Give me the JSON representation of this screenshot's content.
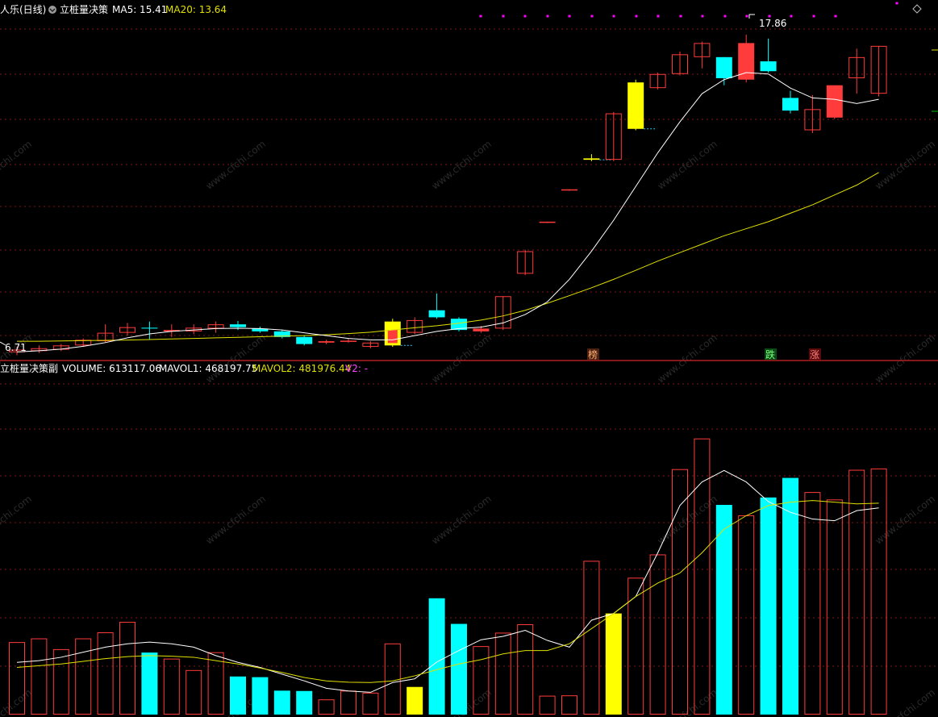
{
  "main_header": {
    "stock_name": "人乐(日线)",
    "indicator": "立桩量决策",
    "ma5_label": "MA5: 15.41",
    "ma20_label": "MA20: 13.64"
  },
  "sub_header": {
    "indicator": "立桩量决策副",
    "volume_label": "VOLUME: 613117.06",
    "mavol1_label": "MAVOL1: 468197.75",
    "mavol2_label": "MAVOL2: 481976.44",
    "v2_label": "V2: -"
  },
  "annotations": {
    "high_label": "17.86",
    "low_label": "6.71",
    "badge_bang": "榜",
    "badge_die": "跌",
    "badge_zhang": "涨"
  },
  "watermark": "www.cfchi.com",
  "colors": {
    "up": "#ff3b3b",
    "down": "#00ffff",
    "yellow": "#ffff00",
    "ma5": "#ffffff",
    "ma20": "#e0e000",
    "grid": "#7a1a1a",
    "separator": "#b02020",
    "magenta": "#ff00ff"
  },
  "chart_data": [
    {
      "type": "candlestick",
      "title": "立桩量决策",
      "price_axis_range": [
        6.5,
        18.6
      ],
      "candles": [
        {
          "o": 6.71,
          "h": 6.9,
          "l": 6.6,
          "c": 6.8,
          "style": "up"
        },
        {
          "o": 6.75,
          "h": 6.95,
          "l": 6.68,
          "c": 6.85,
          "style": "up"
        },
        {
          "o": 6.8,
          "h": 7.0,
          "l": 6.75,
          "c": 6.95,
          "style": "up"
        },
        {
          "o": 6.95,
          "h": 7.2,
          "l": 6.9,
          "c": 7.15,
          "style": "up"
        },
        {
          "o": 7.1,
          "h": 7.7,
          "l": 7.05,
          "c": 7.4,
          "style": "up"
        },
        {
          "o": 7.4,
          "h": 7.75,
          "l": 7.3,
          "c": 7.6,
          "style": "up"
        },
        {
          "o": 7.58,
          "h": 7.8,
          "l": 7.15,
          "c": 7.55,
          "style": "down"
        },
        {
          "o": 7.5,
          "h": 7.7,
          "l": 7.25,
          "c": 7.45,
          "style": "up"
        },
        {
          "o": 7.45,
          "h": 7.7,
          "l": 7.35,
          "c": 7.58,
          "style": "up"
        },
        {
          "o": 7.55,
          "h": 7.8,
          "l": 7.4,
          "c": 7.7,
          "style": "up"
        },
        {
          "o": 7.7,
          "h": 7.82,
          "l": 7.5,
          "c": 7.6,
          "style": "down"
        },
        {
          "o": 7.55,
          "h": 7.62,
          "l": 7.4,
          "c": 7.45,
          "style": "down"
        },
        {
          "o": 7.45,
          "h": 7.5,
          "l": 7.2,
          "c": 7.25,
          "style": "down"
        },
        {
          "o": 7.25,
          "h": 7.32,
          "l": 6.95,
          "c": 7.0,
          "style": "down"
        },
        {
          "o": 7.05,
          "h": 7.15,
          "l": 7.0,
          "c": 7.1,
          "style": "up"
        },
        {
          "o": 7.12,
          "h": 7.2,
          "l": 7.05,
          "c": 7.1,
          "style": "up"
        },
        {
          "o": 6.9,
          "h": 7.1,
          "l": 6.85,
          "c": 7.05,
          "style": "up"
        },
        {
          "o": 7.8,
          "h": 7.9,
          "l": 6.9,
          "c": 6.95,
          "style": "yellow-red"
        },
        {
          "o": 7.4,
          "h": 7.95,
          "l": 7.35,
          "c": 7.85,
          "style": "up"
        },
        {
          "o": 8.2,
          "h": 8.8,
          "l": 7.9,
          "c": 7.95,
          "style": "down"
        },
        {
          "o": 7.9,
          "h": 7.95,
          "l": 7.45,
          "c": 7.5,
          "style": "down"
        },
        {
          "o": 7.55,
          "h": 7.65,
          "l": 7.4,
          "c": 7.45,
          "style": "red"
        },
        {
          "o": 7.55,
          "h": 8.7,
          "l": 7.5,
          "c": 8.7,
          "style": "up"
        },
        {
          "o": 9.5,
          "h": 10.35,
          "l": 9.45,
          "c": 10.3,
          "style": "up"
        },
        {
          "o": 11.35,
          "h": 11.35,
          "l": 11.3,
          "c": 11.35,
          "style": "up"
        },
        {
          "o": 12.5,
          "h": 12.5,
          "l": 12.45,
          "c": 12.5,
          "style": "up"
        },
        {
          "o": 13.6,
          "h": 13.75,
          "l": 13.5,
          "c": 13.55,
          "style": "yellow"
        },
        {
          "o": 13.55,
          "h": 15.25,
          "l": 13.5,
          "c": 15.2,
          "style": "up"
        },
        {
          "o": 16.3,
          "h": 16.4,
          "l": 14.6,
          "c": 14.65,
          "style": "yellow"
        },
        {
          "o": 16.1,
          "h": 16.65,
          "l": 16.05,
          "c": 16.6,
          "style": "up"
        },
        {
          "o": 16.6,
          "h": 17.4,
          "l": 16.55,
          "c": 17.3,
          "style": "up"
        },
        {
          "o": 17.2,
          "h": 17.75,
          "l": 16.8,
          "c": 17.7,
          "style": "up"
        },
        {
          "o": 17.2,
          "h": 17.2,
          "l": 16.2,
          "c": 16.45,
          "style": "down"
        },
        {
          "o": 17.7,
          "h": 18.0,
          "l": 16.3,
          "c": 16.4,
          "style": "red"
        },
        {
          "o": 17.05,
          "h": 17.86,
          "l": 16.65,
          "c": 16.7,
          "style": "down"
        },
        {
          "o": 15.75,
          "h": 16.0,
          "l": 15.2,
          "c": 15.3,
          "style": "down"
        },
        {
          "o": 14.6,
          "h": 15.85,
          "l": 14.5,
          "c": 15.35,
          "style": "up"
        },
        {
          "o": 16.2,
          "h": 16.2,
          "l": 15.0,
          "c": 15.05,
          "style": "red"
        },
        {
          "o": 16.45,
          "h": 17.5,
          "l": 15.9,
          "c": 17.2,
          "style": "up"
        },
        {
          "o": 15.9,
          "h": 17.6,
          "l": 15.8,
          "c": 17.6,
          "style": "up"
        }
      ],
      "ma5": [
        6.72,
        6.76,
        6.82,
        6.92,
        7.05,
        7.22,
        7.36,
        7.45,
        7.5,
        7.55,
        7.56,
        7.55,
        7.5,
        7.4,
        7.3,
        7.2,
        7.15,
        7.15,
        7.3,
        7.45,
        7.55,
        7.6,
        7.75,
        8.05,
        8.5,
        9.3,
        10.3,
        11.4,
        12.6,
        13.8,
        14.9,
        15.9,
        16.4,
        16.65,
        16.6,
        16.1,
        15.75,
        15.7,
        15.55,
        15.7
      ],
      "ma20": [
        7.1,
        7.1,
        7.11,
        7.12,
        7.13,
        7.14,
        7.16,
        7.18,
        7.2,
        7.22,
        7.24,
        7.26,
        7.28,
        7.3,
        7.33,
        7.37,
        7.42,
        7.5,
        7.58,
        7.65,
        7.74,
        7.85,
        8.0,
        8.2,
        8.45,
        8.72,
        9.0,
        9.3,
        9.62,
        9.95,
        10.25,
        10.55,
        10.85,
        11.1,
        11.35,
        11.65,
        11.95,
        12.3,
        12.65,
        13.1
      ],
      "labels": [
        "17.86",
        "6.71"
      ]
    },
    {
      "type": "bar",
      "title": "立桩量决策副",
      "volume_axis_range": [
        0,
        1000000
      ],
      "volume": [
        215000,
        226000,
        194000,
        226000,
        244000,
        275000,
        184000,
        166000,
        132000,
        185000,
        113000,
        111000,
        71000,
        70000,
        45000,
        71000,
        65000,
        211000,
        82000,
        345000,
        269000,
        203000,
        243000,
        268000,
        56000,
        57000,
        456000,
        300000,
        406000,
        475000,
        728000,
        819000,
        622000,
        591000,
        644000,
        702000,
        660000,
        638000,
        726000,
        730000
      ],
      "volume_style": [
        "up",
        "up",
        "up",
        "up",
        "up",
        "up",
        "down",
        "up",
        "up",
        "up",
        "down",
        "down",
        "down",
        "down",
        "up",
        "up",
        "up",
        "up",
        "yellow",
        "down",
        "down",
        "up",
        "up",
        "up",
        "up",
        "up",
        "up",
        "yellow",
        "up",
        "up",
        "up",
        "up",
        "down",
        "up",
        "down",
        "down",
        "up",
        "up",
        "up",
        "up"
      ],
      "mavol1": [
        155000,
        160000,
        170000,
        185000,
        200000,
        210000,
        215000,
        210000,
        200000,
        175000,
        155000,
        140000,
        120000,
        100000,
        78000,
        70000,
        66000,
        95000,
        106000,
        156000,
        190000,
        222000,
        232000,
        250000,
        220000,
        200000,
        280000,
        300000,
        350000,
        480000,
        620000,
        690000,
        724000,
        690000,
        632000,
        600000,
        580000,
        575000,
        605000,
        613000
      ],
      "mavol2": [
        140000,
        145000,
        150000,
        158000,
        166000,
        172000,
        175000,
        173000,
        170000,
        160000,
        150000,
        138000,
        125000,
        110000,
        100000,
        96000,
        95000,
        100000,
        115000,
        133000,
        150000,
        163000,
        180000,
        190000,
        190000,
        210000,
        255000,
        300000,
        350000,
        390000,
        420000,
        480000,
        550000,
        590000,
        620000,
        630000,
        635000,
        630000,
        625000,
        627000
      ],
      "legend": [
        "VOLUME",
        "MAVOL1",
        "MAVOL2",
        "V2"
      ]
    }
  ]
}
